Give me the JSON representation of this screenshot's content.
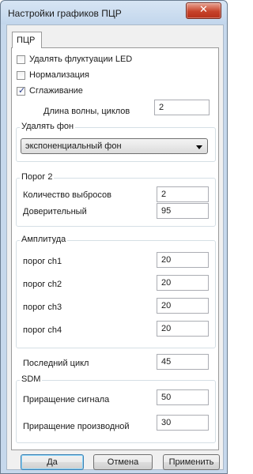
{
  "window": {
    "title": "Настройки графиков ПЦР",
    "close_glyph": "✕"
  },
  "tabs": [
    {
      "label": "ПЦР",
      "active": true
    }
  ],
  "checkboxes": [
    {
      "label": "Удалять флуктуации LED",
      "checked": false
    },
    {
      "label": "Нормализация",
      "checked": false
    },
    {
      "label": "Сглаживание",
      "checked": true
    }
  ],
  "wavelength": {
    "label": "Длина волны, циклов",
    "value": "2"
  },
  "background": {
    "title": "Удалять фон",
    "selected": "экспоненциальный фон"
  },
  "threshold2": {
    "title": "Порог 2",
    "outliers_label": "Количество выбросов",
    "outliers_value": "2",
    "confidence_label": "Доверительный",
    "confidence_value": "95"
  },
  "amplitude": {
    "title": "Амплитуда",
    "channels": [
      {
        "label": "порог ch1",
        "value": "20"
      },
      {
        "label": "порог ch2",
        "value": "20"
      },
      {
        "label": "порог ch3",
        "value": "20"
      },
      {
        "label": "порог ch4",
        "value": "20"
      }
    ]
  },
  "last_cycle": {
    "label": "Последний цикл",
    "value": "45"
  },
  "sdm": {
    "title": "SDM",
    "signal_label": "Приращение сигнала",
    "signal_value": "50",
    "derivative_label": "Приращение производной",
    "derivative_value": "30"
  },
  "buttons": {
    "ok": "Да",
    "cancel": "Отмена",
    "apply": "Применить"
  },
  "colors": {
    "frame": "#c6d8ec",
    "close": "#c7432b",
    "accent": "#3c7fb1"
  }
}
